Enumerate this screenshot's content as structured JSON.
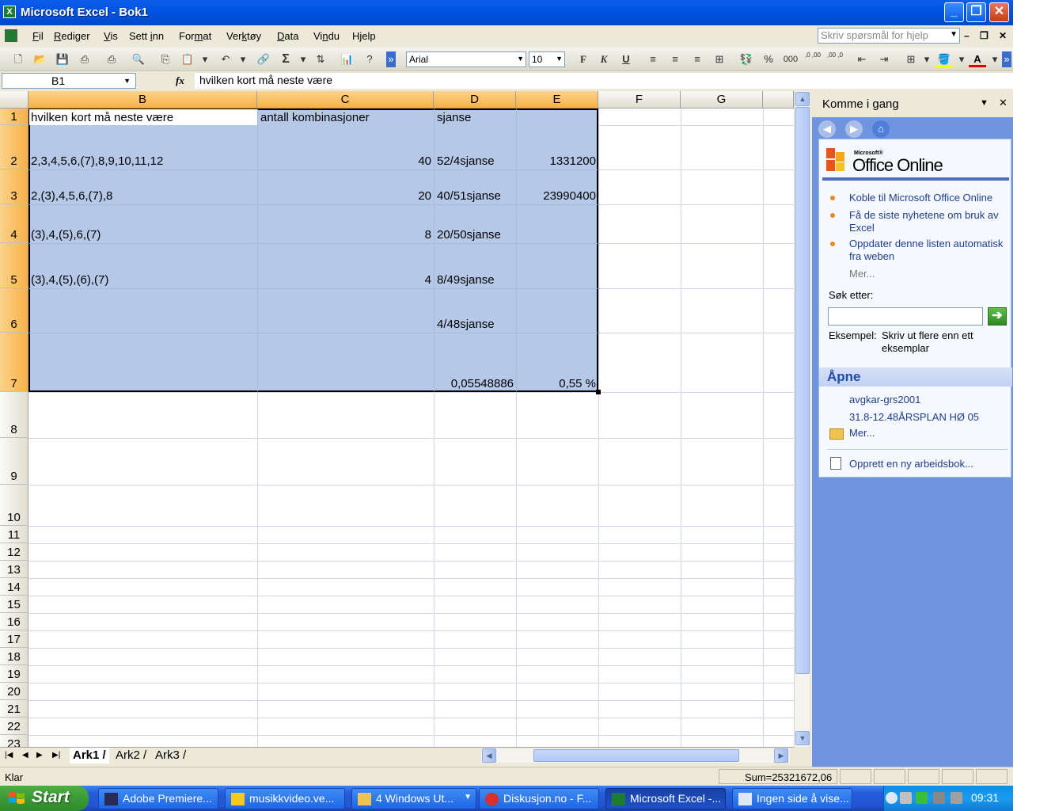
{
  "window": {
    "title": "Microsoft Excel - Bok1"
  },
  "menu": [
    {
      "label": "Fil",
      "key": "F"
    },
    {
      "label": "Rediger",
      "key": "R"
    },
    {
      "label": "Vis",
      "key": "V"
    },
    {
      "label": "Sett inn",
      "key": "i"
    },
    {
      "label": "Format",
      "key": "m"
    },
    {
      "label": "Verktøy",
      "key": "k"
    },
    {
      "label": "Data",
      "key": "D"
    },
    {
      "label": "Vindu",
      "key": "n"
    },
    {
      "label": "Hjelp",
      "key": "j"
    }
  ],
  "help_box": {
    "placeholder": "Skriv spørsmål for hjelp"
  },
  "format_toolbar": {
    "font": "Arial",
    "size": "10",
    "bold": "F",
    "italic": "K",
    "underline": "U",
    "percent": "%",
    "thousands": "000",
    "inc_dec": ",0 ,00",
    "dec_dec": ",00 ,0"
  },
  "formula_bar": {
    "name_box": "B1",
    "fx": "fx",
    "content": "hvilken kort må neste være"
  },
  "columns": [
    "B",
    "C",
    "D",
    "E",
    "F",
    "G"
  ],
  "selected_columns": [
    "B",
    "C",
    "D",
    "E"
  ],
  "rows": [
    "1",
    "2",
    "3",
    "4",
    "5",
    "6",
    "7",
    "8",
    "9",
    "10",
    "11",
    "12",
    "13",
    "14",
    "15",
    "16",
    "17",
    "18",
    "19",
    "20",
    "21",
    "22",
    "23"
  ],
  "selected_rows": [
    "1",
    "2",
    "3",
    "4",
    "5",
    "6",
    "7"
  ],
  "cells": {
    "B1": "hvilken kort må neste være",
    "C1": "antall kombinasjoner",
    "D1": "sjanse",
    "B2": "2,3,4,5,6,(7),8,9,10,11,12",
    "C2": "40",
    "D2": "52/4sjanse",
    "E2": "1331200",
    "B3": "2,(3),4,5,6,(7),8",
    "C3": "20",
    "D3": "40/51sjanse",
    "E3": "23990400",
    "B4": "(3),4,(5),6,(7)",
    "C4": "8",
    "D4": "20/50sjanse",
    "B5": "(3),4,(5),(6),(7)",
    "C5": "4",
    "D5": "8/49sjanse",
    "D6": "4/48sjanse",
    "D7": "0,05548886",
    "E7": "0,55 %"
  },
  "sheets": [
    "Ark1",
    "Ark2",
    "Ark3"
  ],
  "active_sheet": "Ark1",
  "status": {
    "state": "Klar",
    "sum": "Sum=25321672,06"
  },
  "task_pane": {
    "title": "Komme i gang",
    "logo_small": "Microsoft®",
    "logo": "Office Online",
    "links": [
      "Koble til Microsoft Office Online",
      "Få de siste nyhetene om bruk av Excel",
      "Oppdater denne listen automatisk fra weben"
    ],
    "more_1": "Mer...",
    "search_label": "Søk etter:",
    "example_label": "Eksempel:",
    "example_text": "Skriv ut flere enn ett eksemplar",
    "open_header": "Åpne",
    "recent_files": [
      "avgkar-grs2001",
      "31.8-12.48ÅRSPLAN HØ 05"
    ],
    "more_2": "Mer...",
    "new_workbook": "Opprett en ny arbeidsbok..."
  },
  "taskbar": {
    "start": "Start",
    "tasks": [
      "Adobe Premiere...",
      "musikkvideo.ve...",
      "4 Windows Ut...",
      "Diskusjon.no - F...",
      "Microsoft Excel -...",
      "Ingen side å vise..."
    ],
    "active_task": "Microsoft Excel -...",
    "clock": "09:31"
  },
  "colors": {
    "selection": "#b6c8e8",
    "header_selected": "#f8b047",
    "title_bar": "#0054e3",
    "start_green": "#3c9a36"
  }
}
